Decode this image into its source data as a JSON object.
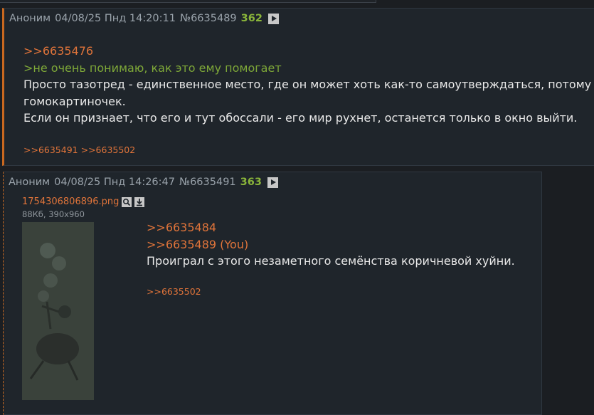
{
  "post1": {
    "author": "Аноним",
    "date": "04/08/25 Пнд 14:20:11",
    "number": "№6635489",
    "count": "362",
    "reply_link": ">>6635476",
    "greentext": ">не очень понимаю, как это ему помогает",
    "line1": "Просто тазотред - единственное место, где он может хоть как-то самоутверждаться, потому",
    "line2": "гомокартиночек.",
    "line3": "Если он признает, что его и тут обоссали - его мир рухнет, останется только в окно выйти.",
    "replies": ">>6635491 >>6635502"
  },
  "post2": {
    "author": "Аноним",
    "date": "04/08/25 Пнд 14:26:47",
    "number": "№6635491",
    "count": "363",
    "file_name": "1754306806896.png",
    "file_meta": "88Кб, 390x960",
    "reply_link1": ">>6635484",
    "reply_link2": ">>6635489 (You)",
    "text": "Проиграл с этого незаметного семёнства коричневой хуйни.",
    "replies": ">>6635502"
  },
  "icons": {
    "play": "play-icon",
    "search": "search-icon",
    "download": "download-icon"
  }
}
